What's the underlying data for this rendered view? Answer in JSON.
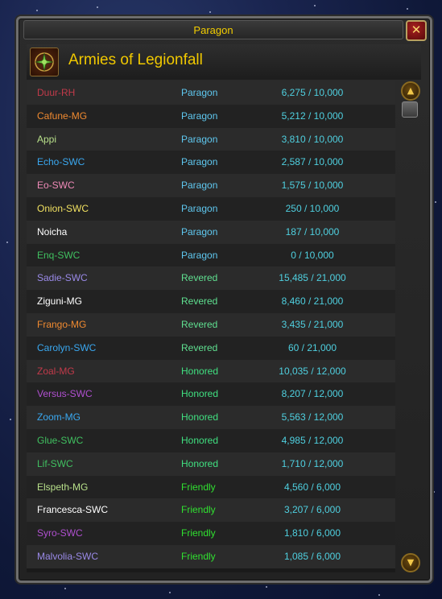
{
  "window": {
    "title": "Paragon",
    "close_label": "✕"
  },
  "faction": {
    "name": "Armies of Legionfall",
    "emblem_icon": "legionfall-emblem-icon"
  },
  "colors": {
    "paragon": "#5fc8f0",
    "revered": "#5fe090",
    "honored": "#40e080",
    "friendly": "#30e030",
    "progress": "#4fd0e0",
    "title_gold": "#f2cd00"
  },
  "rows": [
    {
      "name": "Duur-RH",
      "name_color": "#c23a4a",
      "standing": "Paragon",
      "progress": "6,275 / 10,000"
    },
    {
      "name": "Cafune-MG",
      "name_color": "#f08a30",
      "standing": "Paragon",
      "progress": "5,212 / 10,000"
    },
    {
      "name": "Appi",
      "name_color": "#b8e08a",
      "standing": "Paragon",
      "progress": "3,810 / 10,000"
    },
    {
      "name": "Echo-SWC",
      "name_color": "#3aa8f0",
      "standing": "Paragon",
      "progress": "2,587 / 10,000"
    },
    {
      "name": "Eo-SWC",
      "name_color": "#f08ab8",
      "standing": "Paragon",
      "progress": "1,575 / 10,000"
    },
    {
      "name": "Onion-SWC",
      "name_color": "#f0e060",
      "standing": "Paragon",
      "progress": "250 / 10,000"
    },
    {
      "name": "Noicha",
      "name_color": "#ffffff",
      "standing": "Paragon",
      "progress": "187 / 10,000"
    },
    {
      "name": "Enq-SWC",
      "name_color": "#40c060",
      "standing": "Paragon",
      "progress": "0 / 10,000"
    },
    {
      "name": "Sadie-SWC",
      "name_color": "#9a8ae8",
      "standing": "Revered",
      "progress": "15,485 / 21,000"
    },
    {
      "name": "Ziguni-MG",
      "name_color": "#ffffff",
      "standing": "Revered",
      "progress": "8,460 / 21,000"
    },
    {
      "name": "Frango-MG",
      "name_color": "#f08a30",
      "standing": "Revered",
      "progress": "3,435 / 21,000"
    },
    {
      "name": "Carolyn-SWC",
      "name_color": "#3aa8f0",
      "standing": "Revered",
      "progress": "60 / 21,000"
    },
    {
      "name": "Zoal-MG",
      "name_color": "#c23a4a",
      "standing": "Honored",
      "progress": "10,035 / 12,000"
    },
    {
      "name": "Versus-SWC",
      "name_color": "#b050d0",
      "standing": "Honored",
      "progress": "8,207 / 12,000"
    },
    {
      "name": "Zoom-MG",
      "name_color": "#3aa8f0",
      "standing": "Honored",
      "progress": "5,563 / 12,000"
    },
    {
      "name": "Glue-SWC",
      "name_color": "#40c060",
      "standing": "Honored",
      "progress": "4,985 / 12,000"
    },
    {
      "name": "Lif-SWC",
      "name_color": "#40c060",
      "standing": "Honored",
      "progress": "1,710 / 12,000"
    },
    {
      "name": "Elspeth-MG",
      "name_color": "#b8e08a",
      "standing": "Friendly",
      "progress": "4,560 / 6,000"
    },
    {
      "name": "Francesca-SWC",
      "name_color": "#ffffff",
      "standing": "Friendly",
      "progress": "3,207 / 6,000"
    },
    {
      "name": "Syro-SWC",
      "name_color": "#b050d0",
      "standing": "Friendly",
      "progress": "1,810 / 6,000"
    },
    {
      "name": "Malvolia-SWC",
      "name_color": "#9a8ae8",
      "standing": "Friendly",
      "progress": "1,085 / 6,000"
    }
  ],
  "scrollbar": {
    "up_icon": "scroll-up-icon",
    "down_icon": "scroll-down-icon"
  }
}
